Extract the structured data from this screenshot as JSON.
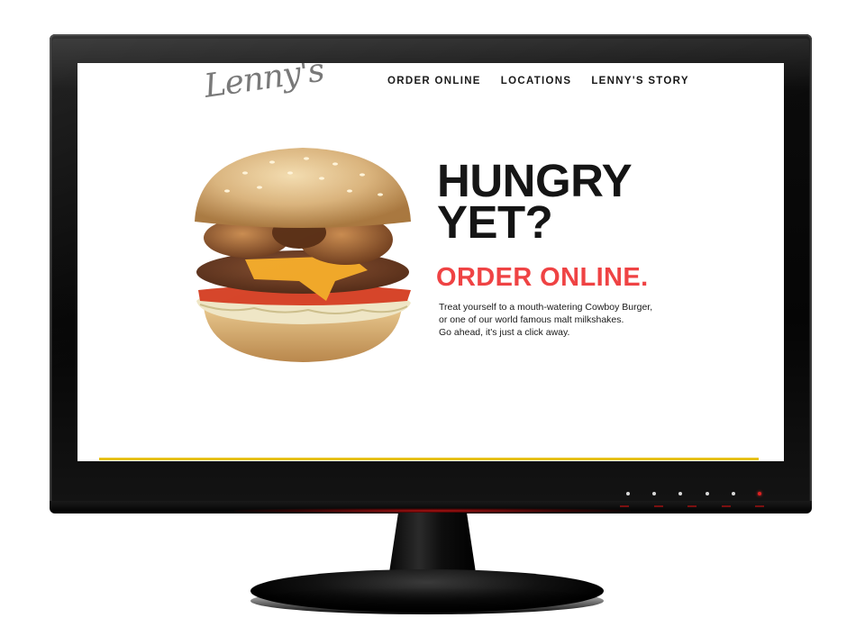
{
  "site": {
    "logo_text": "Lenny's",
    "nav": {
      "items": [
        {
          "label": "ORDER ONLINE"
        },
        {
          "label": "LOCATIONS"
        },
        {
          "label": "LENNY'S STORY"
        }
      ]
    },
    "hero": {
      "headline_line1": "HUNGRY",
      "headline_line2": "YET?",
      "cta": "ORDER ONLINE.",
      "body_lines": [
        "Treat yourself to a mouth-watering Cowboy Burger,",
        "or one of our world famous malt milkshakes.",
        "Go ahead, it's just a click away."
      ],
      "image": "burger-photo"
    }
  },
  "monitor": {
    "control_buttons": [
      "button-1",
      "button-2",
      "button-3",
      "button-4",
      "button-5",
      "power-button"
    ]
  },
  "colors": {
    "accent_red": "#ef4344",
    "headline": "#141414",
    "logo_gray": "#707070",
    "accent_yellow": "#e8c21a",
    "bezel": "#050505"
  }
}
